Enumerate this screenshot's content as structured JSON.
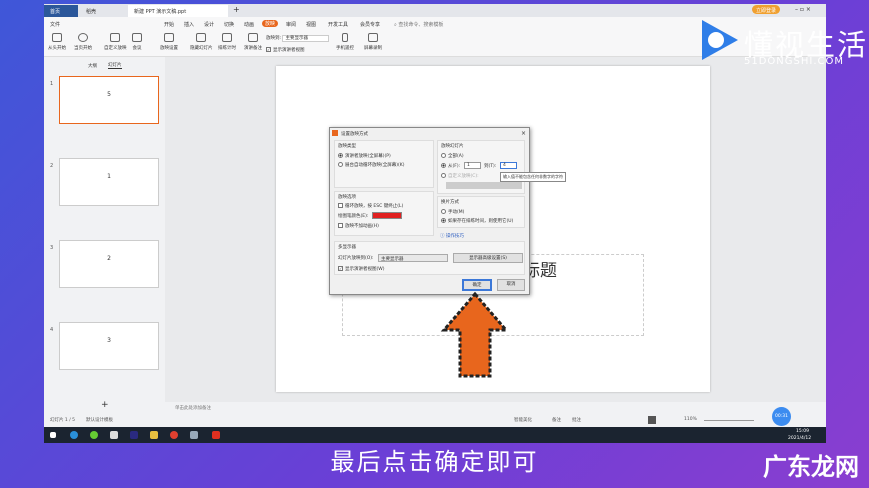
{
  "titlebar": {
    "tabs": [
      "首页",
      "稻壳",
      "新建 PPT 演示文稿.ppt"
    ],
    "login": "立即登录"
  },
  "menu": {
    "file": "文件",
    "items": [
      "开始",
      "插入",
      "设计",
      "切换",
      "动画",
      "放映",
      "审阅",
      "视图",
      "开发工具",
      "会员专享"
    ],
    "active": "放映",
    "search": "查找命令、搜索模板"
  },
  "ribbon": {
    "buttons": [
      "从头开始",
      "当页开始",
      "自定义放映",
      "会议",
      "放映设置",
      "隐藏幻灯片",
      "排练计时",
      "演讲备注",
      "手机遥控",
      "屏幕录制"
    ],
    "display_label": "放映到:",
    "display_value": "主要显示器",
    "show_presenter": "显示演讲者视图"
  },
  "leftpane": {
    "tabs": [
      "大纲",
      "幻灯片"
    ],
    "slides": [
      {
        "num": "1",
        "text": "5"
      },
      {
        "num": "2",
        "text": "1"
      },
      {
        "num": "3",
        "text": "2"
      },
      {
        "num": "4",
        "text": "3"
      }
    ],
    "add": "+"
  },
  "slide": {
    "subtitle": "副标题"
  },
  "notes": "单击此处添加备注",
  "status": {
    "slide": "幻灯片 1 / 5",
    "template": "默认设计模板",
    "beautify": "智能美化",
    "notes": "备注",
    "comments": "批注",
    "zoom": "110%",
    "timer": "00:31"
  },
  "taskbar": {
    "time": "15:09",
    "date": "2021/4/12"
  },
  "dialog": {
    "title": "设置放映方式",
    "type_group": "放映类型",
    "type_options": [
      "演讲者放映(全屏幕)(P)",
      "展台自动循环放映(全屏幕)(K)"
    ],
    "slides_group": "放映幻灯片",
    "all": "全部(A)",
    "from": "从(F):",
    "from_value": "1",
    "to": "到(T):",
    "to_value": "4",
    "custom": "自定义放映(C):",
    "tooltip": "输入值不能包含任何非数字的字符",
    "options_group": "放映选项",
    "loop": "循环放映，按 ESC 键终止(L)",
    "pen_color": "绘图笔颜色(E):",
    "no_anim": "放映不加动画(H)",
    "pen_hex": "#e02020",
    "advance_group": "换片方式",
    "manual": "手动(M)",
    "timing": "如果存在排练时间，则使用它(U)",
    "tips": "操作技巧",
    "multi_group": "多显示器",
    "show_on": "幻灯片放映到(O):",
    "monitor": "主要显示器",
    "advanced": "显示器高级设置(S)",
    "presenter": "显示演讲者视图(W)",
    "ok": "确定",
    "cancel": "取消"
  },
  "overlay": {
    "caption": "最后点击确定即可",
    "brand": "广东龙网",
    "logo_cn": "懂视生活",
    "logo_en": "51DONGSHI.COM"
  }
}
